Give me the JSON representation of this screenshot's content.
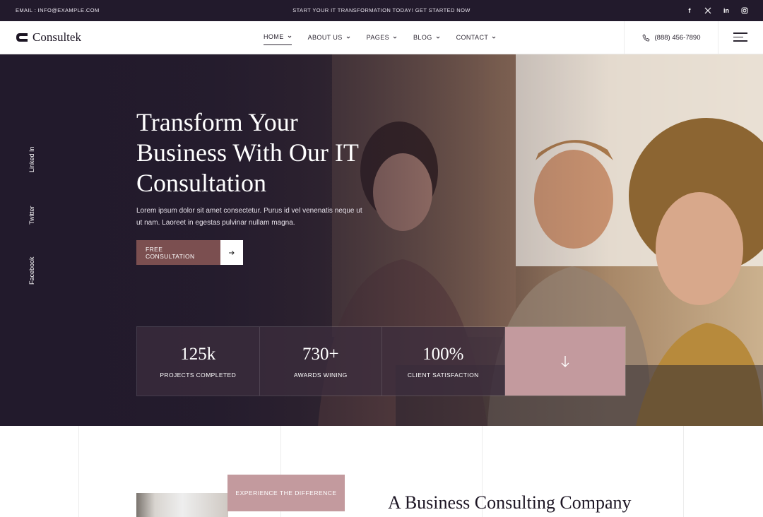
{
  "topbar": {
    "email": "EMAIL : INFO@EXAMPLE.COM",
    "promo_text": "START YOUR IT TRANSFORMATION TODAY!",
    "promo_link": "GET STARTED NOW",
    "socials": [
      "facebook-icon",
      "x-icon",
      "linkedin-icon",
      "instagram-icon"
    ]
  },
  "header": {
    "brand": "Consultek",
    "nav": [
      {
        "label": "HOME",
        "active": true
      },
      {
        "label": "ABOUT US"
      },
      {
        "label": "PAGES"
      },
      {
        "label": "BLOG"
      },
      {
        "label": "CONTACT"
      }
    ],
    "phone": "(888) 456-7890"
  },
  "hero": {
    "title": "Transform Your Business With Our IT Consultation",
    "lead": "Lorem ipsum dolor sit amet consectetur. Purus id vel venenatis neque ut ut nam. Laoreet in egestas pulvinar nullam magna.",
    "cta_label": "FREE CONSULTATION",
    "side_socials": [
      "Linked In",
      "Twitter",
      "Facebook"
    ],
    "stats": [
      {
        "value": "125k",
        "label": "PROJECTS COMPLETED"
      },
      {
        "value": "730+",
        "label": "AWARDS WINING"
      },
      {
        "value": "100%",
        "label": "CLIENT SATISFACTION"
      }
    ]
  },
  "section": {
    "tag": "EXPERIENCE THE DIFFERENCE",
    "heading": "A Business Consulting Company"
  },
  "colors": {
    "dark": "#221a2c",
    "accent": "#7b4f50",
    "rose": "#c39a9e"
  }
}
